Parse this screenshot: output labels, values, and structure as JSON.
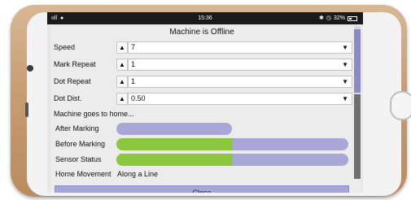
{
  "status_bar": {
    "signal_text": "ııll",
    "time": "15:36",
    "battery": "32%"
  },
  "window": {
    "title": "Machine is Offline"
  },
  "settings": [
    {
      "label": "Speed",
      "value": "7"
    },
    {
      "label": "Mark Repeat",
      "value": "1"
    },
    {
      "label": "Dot Repeat",
      "value": "1"
    },
    {
      "label": "Dot Dist.",
      "value": "0.50"
    }
  ],
  "home_section": {
    "heading": "Machine goes to home...",
    "options": [
      {
        "label": "After Marking",
        "level": 0.0
      },
      {
        "label": "Before Marking",
        "level": 0.5
      },
      {
        "label": "Sensor Status",
        "level": 0.5
      }
    ]
  },
  "home_movement": {
    "label": "Home Movement",
    "value": "Along a Line"
  },
  "buttons": {
    "close": "Close"
  },
  "icons": {
    "spin_up": "▲",
    "dropdown": "▼"
  },
  "colors": {
    "track": "#a9a6d8",
    "fill": "#8cc63f",
    "accent": "#8b8bc3"
  }
}
